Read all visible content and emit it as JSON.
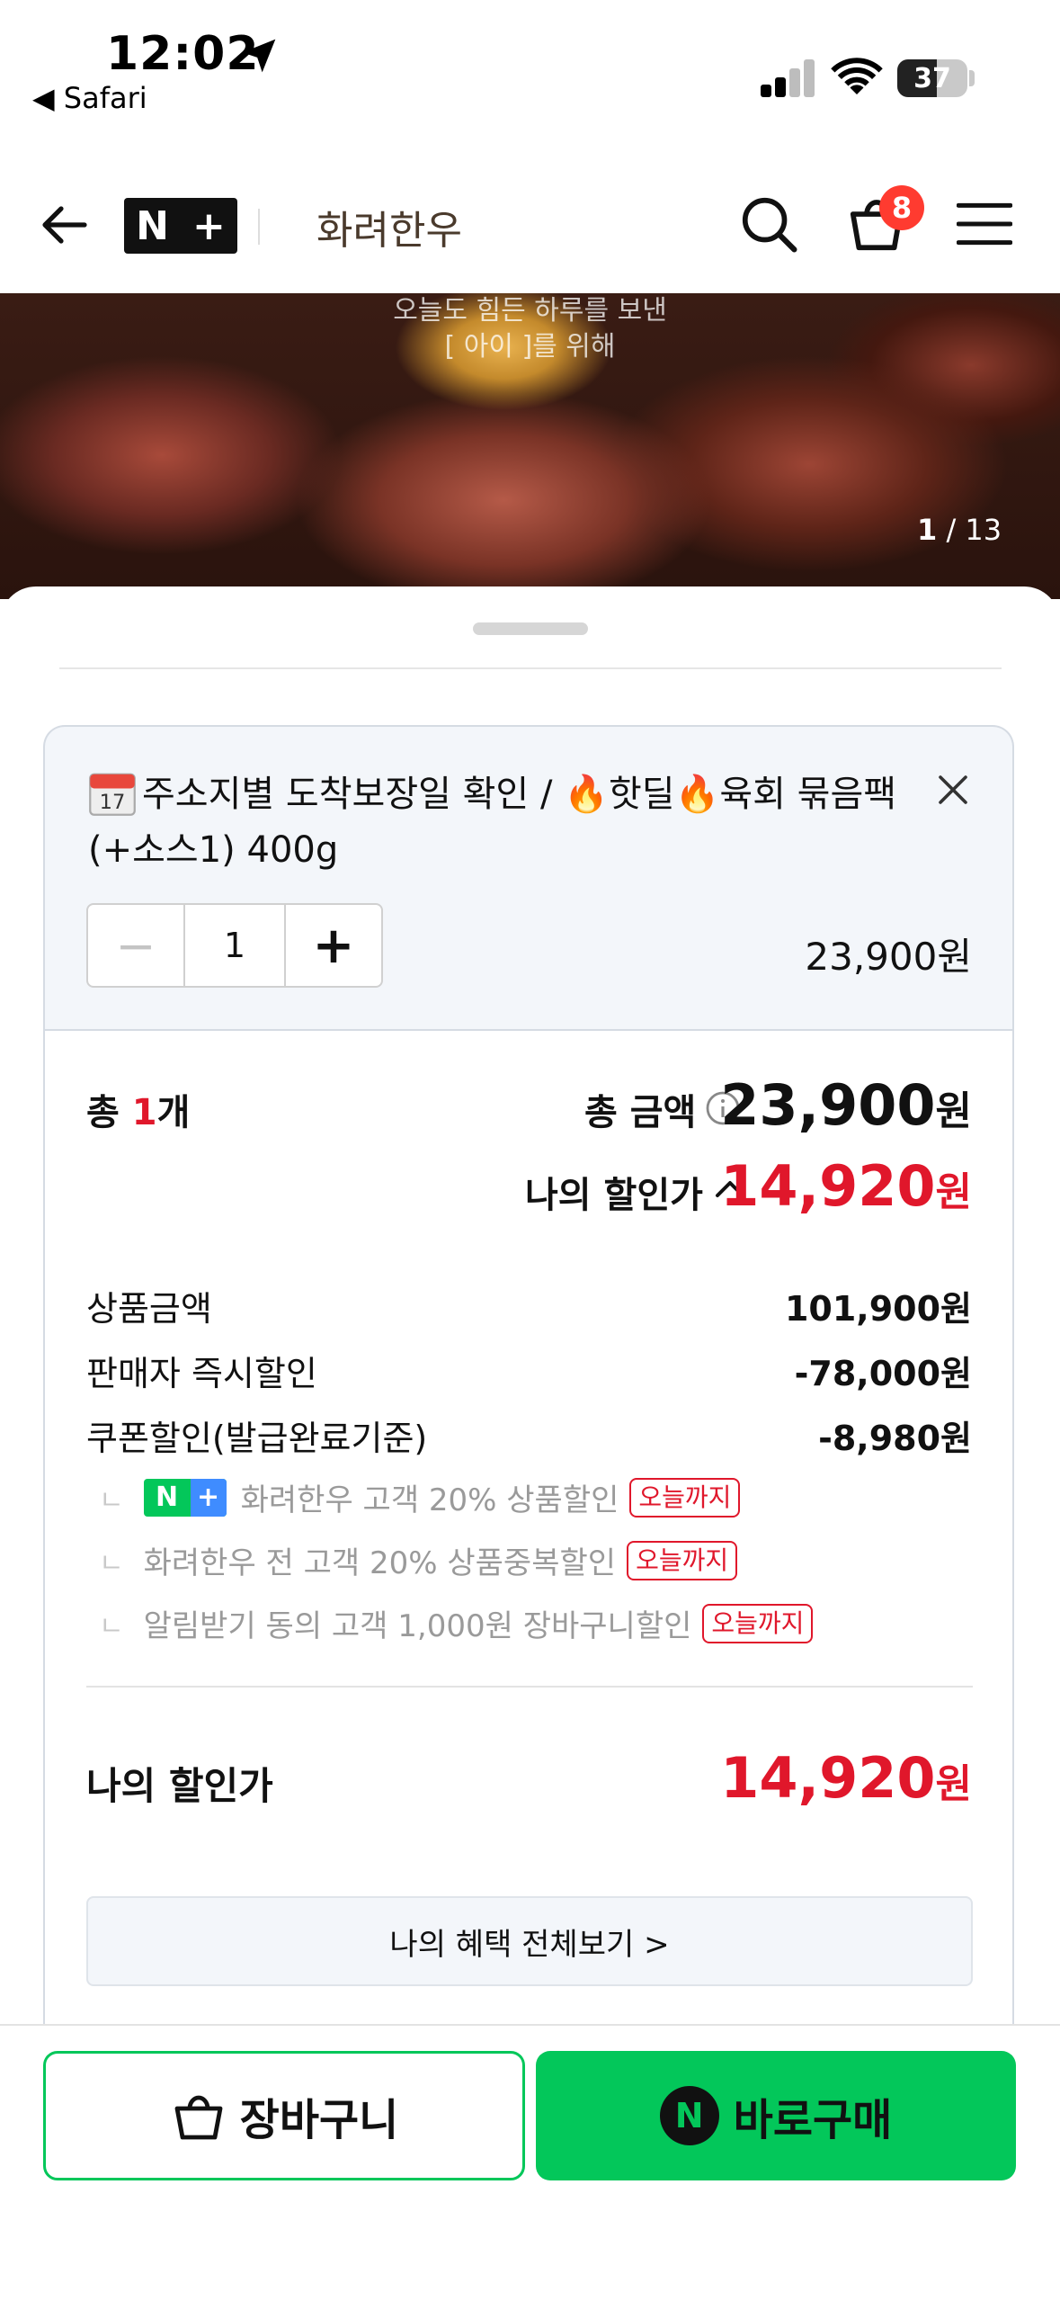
{
  "status_bar": {
    "time": "12:02",
    "back_app": "◀ Safari",
    "battery": "37"
  },
  "header": {
    "logo_text": "N",
    "logo_plus": "+",
    "store_name": "화려한우",
    "cart_badge": "8"
  },
  "hero": {
    "caption_line1": "오늘도 힘든 하루를 보낸",
    "caption_line2": "[ 아이 ]를 위해",
    "counter_current": "1",
    "counter_total": "/ 13"
  },
  "option": {
    "title": "주소지별 도착보장일 확인 / 🔥핫딜🔥육회 묶음팩(+소스1) 400g",
    "quantity": "1",
    "minus": "−",
    "plus": "+",
    "price": "23,900원"
  },
  "summary": {
    "total_prefix": "총 ",
    "total_count": "1",
    "total_suffix": "개",
    "total_amount_label": "총 금액",
    "total_amount": "23,900",
    "won": "원",
    "my_price_label": "나의 할인가",
    "my_price": "14,920",
    "rows": [
      {
        "label": "상품금액",
        "value": "101,900원"
      },
      {
        "label": "판매자 즉시할인",
        "value": "-78,000원"
      },
      {
        "label": "쿠폰할인(발급완료기준)",
        "value": "-8,980원"
      }
    ],
    "coupons": [
      {
        "text": "화려한우 고객 20% 상품할인",
        "tag": "오늘까지"
      },
      {
        "text": "화려한우 전 고객 20% 상품중복할인",
        "tag": "오늘까지"
      },
      {
        "text": "알림받기 동의 고객 1,000원 장바구니할인",
        "tag": "오늘까지"
      }
    ],
    "coupon_elbow": "ㄴ",
    "final_label": "나의 할인가",
    "final_price": "14,920",
    "benefit_button": "나의 혜택 전체보기 >"
  },
  "actions": {
    "cart_label": "장바구니",
    "buy_label": "바로구매",
    "npay_letter": "N"
  },
  "colors": {
    "accent_green": "#03c75a",
    "price_red": "#e0172b",
    "badge_red": "#ff3b30"
  }
}
